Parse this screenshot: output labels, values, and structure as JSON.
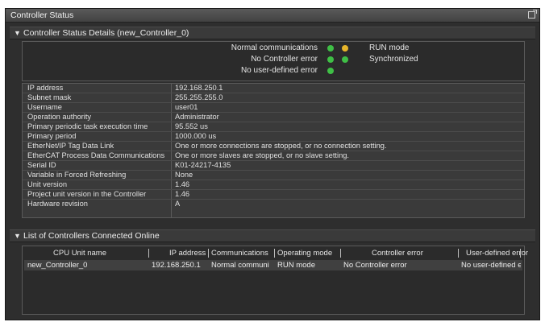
{
  "window": {
    "title": "Controller Status"
  },
  "details": {
    "header": "Controller Status Details (new_Controller_0)",
    "status": {
      "normal_communications": "Normal communications",
      "no_controller_error": "No Controller error",
      "no_user_defined_error": "No user-defined error",
      "run_mode": "RUN mode",
      "synchronized": "Synchronized"
    },
    "rows": [
      {
        "key": "IP address",
        "value": "192.168.250.1"
      },
      {
        "key": "Subnet mask",
        "value": "255.255.255.0"
      },
      {
        "key": "Username",
        "value": "user01"
      },
      {
        "key": "Operation authority",
        "value": "Administrator"
      },
      {
        "key": "Primary periodic task execution time",
        "value": "95.552 us"
      },
      {
        "key": "Primary period",
        "value": "1000.000 us"
      },
      {
        "key": "EtherNet/IP Tag Data Link",
        "value": "One or more connections are stopped, or no connection setting."
      },
      {
        "key": "EtherCAT Process Data Communications",
        "value": "One or more slaves are stopped, or no slave setting."
      },
      {
        "key": "Serial ID",
        "value": "K01-24217-4135"
      },
      {
        "key": "Variable in Forced Refreshing",
        "value": "None"
      },
      {
        "key": "Unit version",
        "value": "1.46"
      },
      {
        "key": "Project unit version in the Controller",
        "value": "1.46"
      },
      {
        "key": "Hardware revision",
        "value": "A"
      }
    ]
  },
  "online": {
    "header": "List of Controllers Connected Online",
    "columns": [
      "CPU Unit name",
      "IP address",
      "Communications",
      "Operating mode",
      "Controller error",
      "User-defined error"
    ],
    "rows": [
      {
        "cpu_unit_name": "new_Controller_0",
        "ip_address": "192.168.250.1",
        "communications": "Normal communi",
        "operating_mode": "RUN mode",
        "controller_error": "No Controller error",
        "user_defined_error": "No user-defined erro"
      }
    ]
  },
  "colors": {
    "panel_bg": "#2e2e2e",
    "status_green": "#3fbf46",
    "status_yellow": "#e7b52a"
  }
}
